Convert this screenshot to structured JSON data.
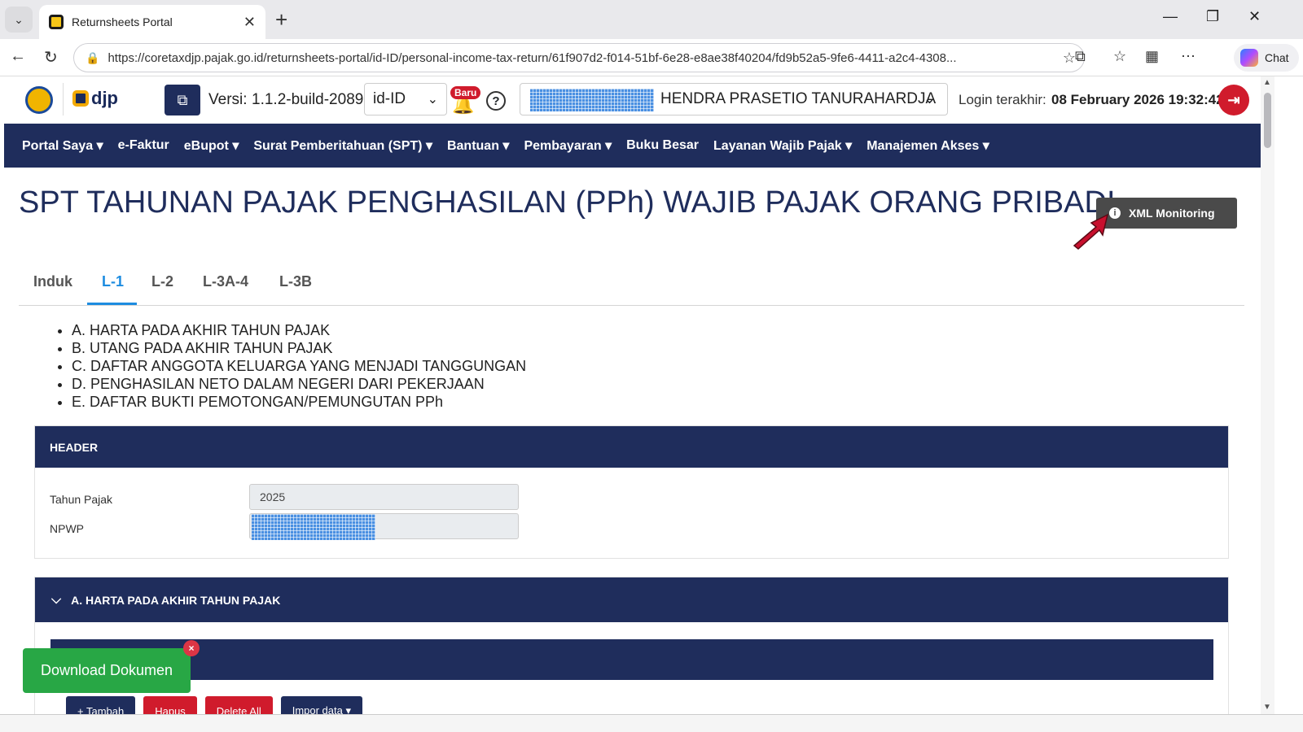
{
  "browser": {
    "tab_title": "Returnsheets Portal",
    "url": "https://coretaxdjp.pajak.go.id/returnsheets-portal/id-ID/personal-income-tax-return/61f907d2-f014-51bf-6e28-e8ae38f40204/fd9b52a5-9fe6-4411-a2c4-4308...",
    "chat_label": "Chat"
  },
  "header": {
    "logo_text": "djp",
    "versi_label": "Versi:",
    "versi_value": "1.1.2-build-2089",
    "language": "id-ID",
    "badge": "Baru",
    "help": "?",
    "user_name_suffix": "HENDRA PRASETIO TANURAHARDJA",
    "login_label": "Login terakhir:",
    "login_value": "08 February 2026 19:32:42"
  },
  "nav": [
    {
      "label": "Portal Saya ▾"
    },
    {
      "label": "e-Faktur"
    },
    {
      "label": "eBupot ▾"
    },
    {
      "label": "Surat Pemberitahuan (SPT) ▾"
    },
    {
      "label": "Bantuan ▾"
    },
    {
      "label": "Pembayaran ▾"
    },
    {
      "label": "Buku Besar"
    },
    {
      "label": "Layanan Wajib Pajak ▾"
    },
    {
      "label": "Manajemen Akses ▾"
    }
  ],
  "page": {
    "title": "SPT TAHUNAN PAJAK PENGHASILAN (PPh) WAJIB PAJAK ORANG PRIBADI",
    "xml_button": "XML Monitoring",
    "tabs": [
      "Induk",
      "L-1",
      "L-2",
      "L-3A-4",
      "L-3B"
    ],
    "active_tab": "L-1",
    "sections_list": [
      "A. HARTA PADA AKHIR TAHUN PAJAK",
      "B. UTANG PADA AKHIR TAHUN PAJAK",
      "C. DAFTAR ANGGOTA KELUARGA YANG MENJADI TANGGUNGAN",
      "D. PENGHASILAN NETO DALAM NEGERI DARI PEKERJAAN",
      "E. DAFTAR BUKTI PEMOTONGAN/PEMUNGUTAN PPh"
    ]
  },
  "header_card": {
    "title": "HEADER",
    "tahun_label": "Tahun Pajak",
    "tahun_value": "2025",
    "npwp_label": "NPWP"
  },
  "section_a": {
    "title": "A. HARTA PADA AKHIR TAHUN PAJAK",
    "buttons": [
      "+ Tambah",
      "Hapus",
      "Delete All",
      "Impor data ▾"
    ]
  },
  "download": {
    "label": "Download Dokumen",
    "close": "×"
  },
  "colors": {
    "navy": "#1f2d5c",
    "accent_blue": "#1d8ce0",
    "danger": "#d01b2c",
    "success": "#28a745"
  }
}
